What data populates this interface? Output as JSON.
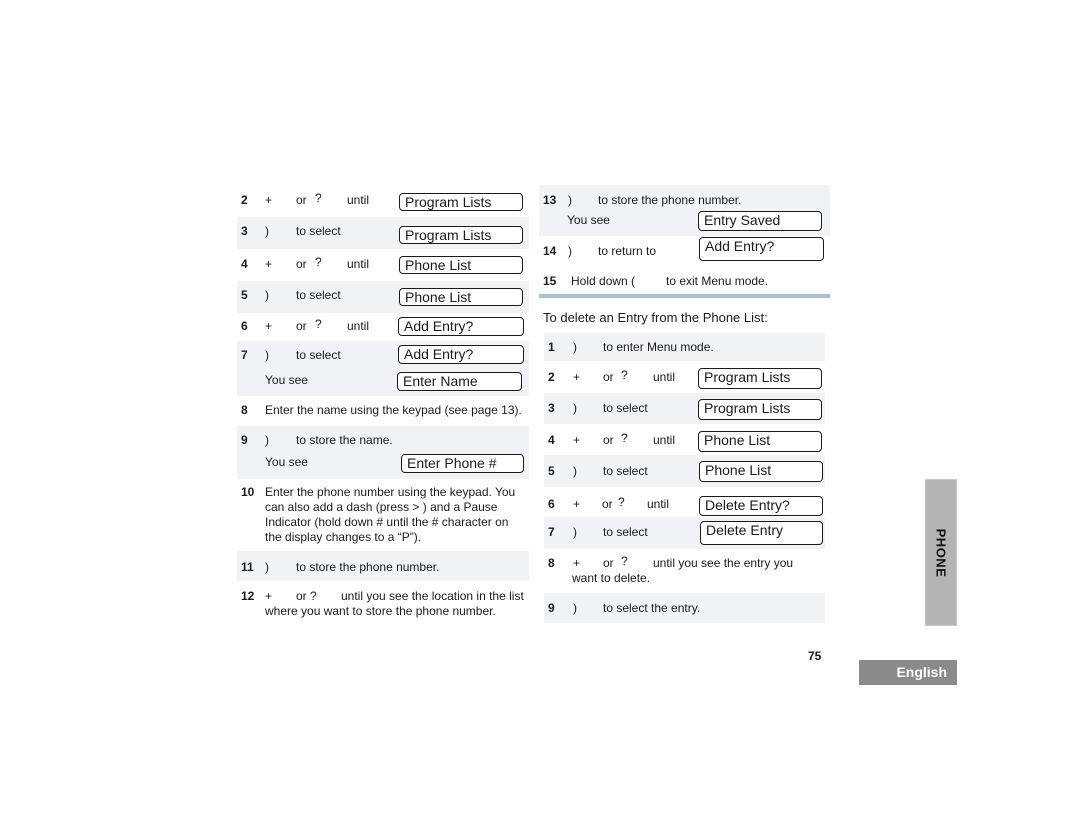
{
  "left_steps": [
    {
      "num": "2",
      "sym": "+",
      "or": "or",
      "sym2": "?",
      "text": "until",
      "lcd": "Program Lists"
    },
    {
      "num": "3",
      "sym": ")",
      "text": "to select",
      "lcd": "Program Lists"
    },
    {
      "num": "4",
      "sym": "+",
      "or": "or",
      "sym2": "?",
      "text": "until",
      "lcd": "Phone List"
    },
    {
      "num": "5",
      "sym": ")",
      "text": "to select",
      "lcd": "Phone List"
    },
    {
      "num": "6",
      "sym": "+",
      "or": "or",
      "sym2": "?",
      "text": "until",
      "lcd": "Add Entry?"
    },
    {
      "num": "7",
      "sym": ")",
      "text": "to select",
      "lcd": "Add Entry?",
      "you_see": "You see",
      "lcd2": "Enter Name"
    },
    {
      "num": "8",
      "text": "Enter the name using the keypad (see page 13)."
    },
    {
      "num": "9",
      "sym": ")",
      "text": "to store the name.",
      "you_see": "You see",
      "lcd2": "Enter Phone #"
    },
    {
      "num": "10",
      "text": "Enter the phone number using the keypad. You can also add a dash (press >      ) and a Pause Indicator (hold down #       until the # character on the display changes to a “P”)."
    },
    {
      "num": "11",
      "sym": ")",
      "text": "to store the phone number."
    },
    {
      "num": "12",
      "sym": "+",
      "or": "or ?",
      "text": "until you see the location in the list",
      "text2": "where you want to store the phone number."
    }
  ],
  "right_top_steps": [
    {
      "num": "13",
      "sym": ")",
      "text": "to store the phone number.",
      "you_see": "You see",
      "lcd": "Entry Saved"
    },
    {
      "num": "14",
      "sym": ")",
      "text": "to return to",
      "lcd": "Add Entry?"
    },
    {
      "num": "15",
      "text": "Hold down (",
      "text2": "to exit Menu mode."
    }
  ],
  "delete_section": {
    "heading": "To delete an Entry from the Phone List:",
    "steps": [
      {
        "num": "1",
        "sym": ")",
        "text": "to enter Menu mode."
      },
      {
        "num": "2",
        "sym": "+",
        "or": "or",
        "sym2": "?",
        "text": "until",
        "lcd": "Program Lists"
      },
      {
        "num": "3",
        "sym": ")",
        "text": "to select",
        "lcd": "Program Lists"
      },
      {
        "num": "4",
        "sym": "+",
        "or": "or",
        "sym2": "?",
        "text": "until",
        "lcd": "Phone List"
      },
      {
        "num": "5",
        "sym": ")",
        "text": "to select",
        "lcd": "Phone List"
      },
      {
        "num": "6",
        "sym": "+",
        "or": "or",
        "sym2": "?",
        "text": "until",
        "lcd": "Delete Entry?"
      },
      {
        "num": "7",
        "sym": ")",
        "text": "to select",
        "lcd": "Delete Entry"
      },
      {
        "num": "8",
        "sym": "+",
        "or": "or",
        "sym2": "?",
        "text": "until you see the entry you",
        "text2": "want to delete."
      },
      {
        "num": "9",
        "sym": ")",
        "text": "to select the entry."
      }
    ]
  },
  "page_number": "75",
  "side_tab": "PHONE",
  "language_tab": "English",
  "colors": {
    "row_shade": "#f0f3f6",
    "rule": "#a9c3cf",
    "side_tab": "#b4b4b4",
    "language_tab": "#8a8a8a"
  }
}
